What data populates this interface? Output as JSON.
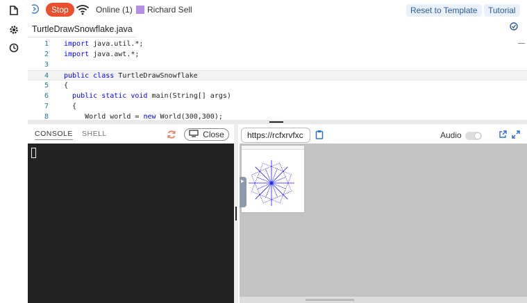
{
  "topbar": {
    "stop_label": "Stop",
    "online_status": "Online (1)",
    "user_name": "Richard Sell",
    "user_color": "#b58ee6",
    "reset_label": "Reset to Template",
    "tutorial_label": "Tutorial"
  },
  "rail": {
    "icons": [
      "file-icon",
      "gear-icon",
      "clock-icon"
    ]
  },
  "editor": {
    "filename": "TurtleDrawSnowflake.java",
    "lines": [
      {
        "num": "1",
        "text": "import java.util.*;"
      },
      {
        "num": "2",
        "text": "import java.awt.*;"
      },
      {
        "num": "3",
        "text": ""
      },
      {
        "num": "4",
        "text": "public class TurtleDrawSnowflake"
      },
      {
        "num": "5",
        "text": "{"
      },
      {
        "num": "6",
        "text": "  public static void main(String[] args)"
      },
      {
        "num": "7",
        "text": "  {"
      },
      {
        "num": "8",
        "text": "     World world = new World(300,300);"
      }
    ]
  },
  "console": {
    "tab_console": "CONSOLE",
    "tab_shell": "SHELL",
    "close_label": "Close"
  },
  "preview": {
    "url": "https://rcfxrvfxc",
    "audio_label": "Audio",
    "audio_on": false
  },
  "colors": {
    "stop": "#e8502e",
    "link": "#2b5a9e",
    "drawing": "#1a1aff"
  }
}
